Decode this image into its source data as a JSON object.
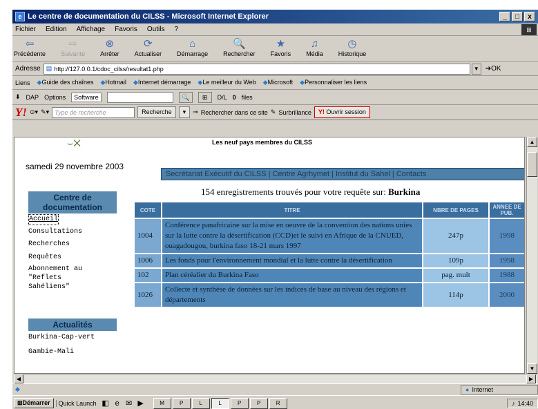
{
  "window": {
    "title": "Le centre de documentation du CILSS - Microsoft Internet Explorer",
    "controls": [
      "_",
      "□",
      "x"
    ]
  },
  "menu": [
    "Fichier",
    "Edition",
    "Affichage",
    "Favoris",
    "Outils",
    "?"
  ],
  "toolbar": [
    {
      "label": "Précédente",
      "icon": "back-arrow-icon",
      "glyph": "⇦"
    },
    {
      "label": "Suivante",
      "icon": "forward-arrow-icon",
      "glyph": "⇨",
      "disabled": true
    },
    {
      "label": "Arrêter",
      "icon": "stop-icon",
      "glyph": "⊗"
    },
    {
      "label": "Actualiser",
      "icon": "refresh-icon",
      "glyph": "⟳"
    },
    {
      "label": "Démarrage",
      "icon": "home-icon",
      "glyph": "⌂"
    },
    {
      "label": "Rechercher",
      "icon": "search-icon",
      "glyph": "🔍"
    },
    {
      "label": "Favoris",
      "icon": "favorites-icon",
      "glyph": "★"
    },
    {
      "label": "Média",
      "icon": "media-icon",
      "glyph": "♫"
    },
    {
      "label": "Historique",
      "icon": "history-icon",
      "glyph": "◷"
    }
  ],
  "address": {
    "label": "Adresse",
    "url": "http://127.0.0.1/cdoc_cilss/resultat1.php",
    "go": "OK"
  },
  "links": {
    "label": "Liens",
    "items": [
      "Guide des chaînes",
      "Hotmail",
      "Internet démarrage",
      "Le meilleur du Web",
      "Microsoft",
      "Personnaliser les liens"
    ]
  },
  "dapbar": {
    "dap": "DAP",
    "options": "Options",
    "software": "Software",
    "dl": "D/L",
    "count": "0",
    "files": "files"
  },
  "yahoo": {
    "logo": "Y!",
    "placeholder": "Type de recherche",
    "search": "Recherche",
    "site_search": "Rechercher dans ce site",
    "highlight": "Surbrillance",
    "open_session": "Ouvrir session"
  },
  "page": {
    "members": "Les neuf pays membres du CILSS",
    "date": "samedi 29 novembre 2003",
    "nav": "Secrétariat Exécutif du CILSS | Centre Agrhymet | Institut du Sahel | Contacts",
    "count_text": "154 enregistrements trouvés pour votre requête sur:",
    "query": "Burkina",
    "side1_title": "Centre de documentation",
    "side1_links": [
      "Accueil",
      "Consultations",
      "Recherches",
      "Requêtes",
      "Abonnement au",
      "\"Reflets",
      "Sahéliens\""
    ],
    "side2_title": "Actualités",
    "side2_links": [
      "Burkina-Cap-vert",
      "Gambie-Mali"
    ]
  },
  "table": {
    "headers": [
      "COTE",
      "TITRE",
      "NBRE DE PAGES",
      "ANNEE DE PUB."
    ],
    "rows": [
      {
        "cote": "1004",
        "titre": "Conférence panafricaine sur la mise en oeuvre de la convention des nations unies sur la lutte contre la désertification (CCD)et le suivi en Afrique de la CNUED, ouagadougou, burkina faso 18-21 mars 1997",
        "pages": "247p",
        "annee": "1998"
      },
      {
        "cote": "1006",
        "titre": "Les fonds pour l'environnement mondial et la lutte contre la désertification",
        "pages": "109p",
        "annee": "1998"
      },
      {
        "cote": "102",
        "titre": "Plan céréalier du Burkina Faso",
        "pages": "pag. mult",
        "annee": "1988"
      },
      {
        "cote": "1026",
        "titre": "Collecte et synthèse de données sur les indices de base au niveau des régions et départements",
        "pages": "114p",
        "annee": "2000"
      }
    ]
  },
  "status": {
    "zone": "Internet"
  },
  "taskbar": {
    "start": "Démarrer",
    "quicklaunch": "Quick Launch",
    "buttons": [
      "M",
      "P",
      "L",
      "L",
      "P",
      "P",
      "R"
    ],
    "time": "14:40"
  }
}
